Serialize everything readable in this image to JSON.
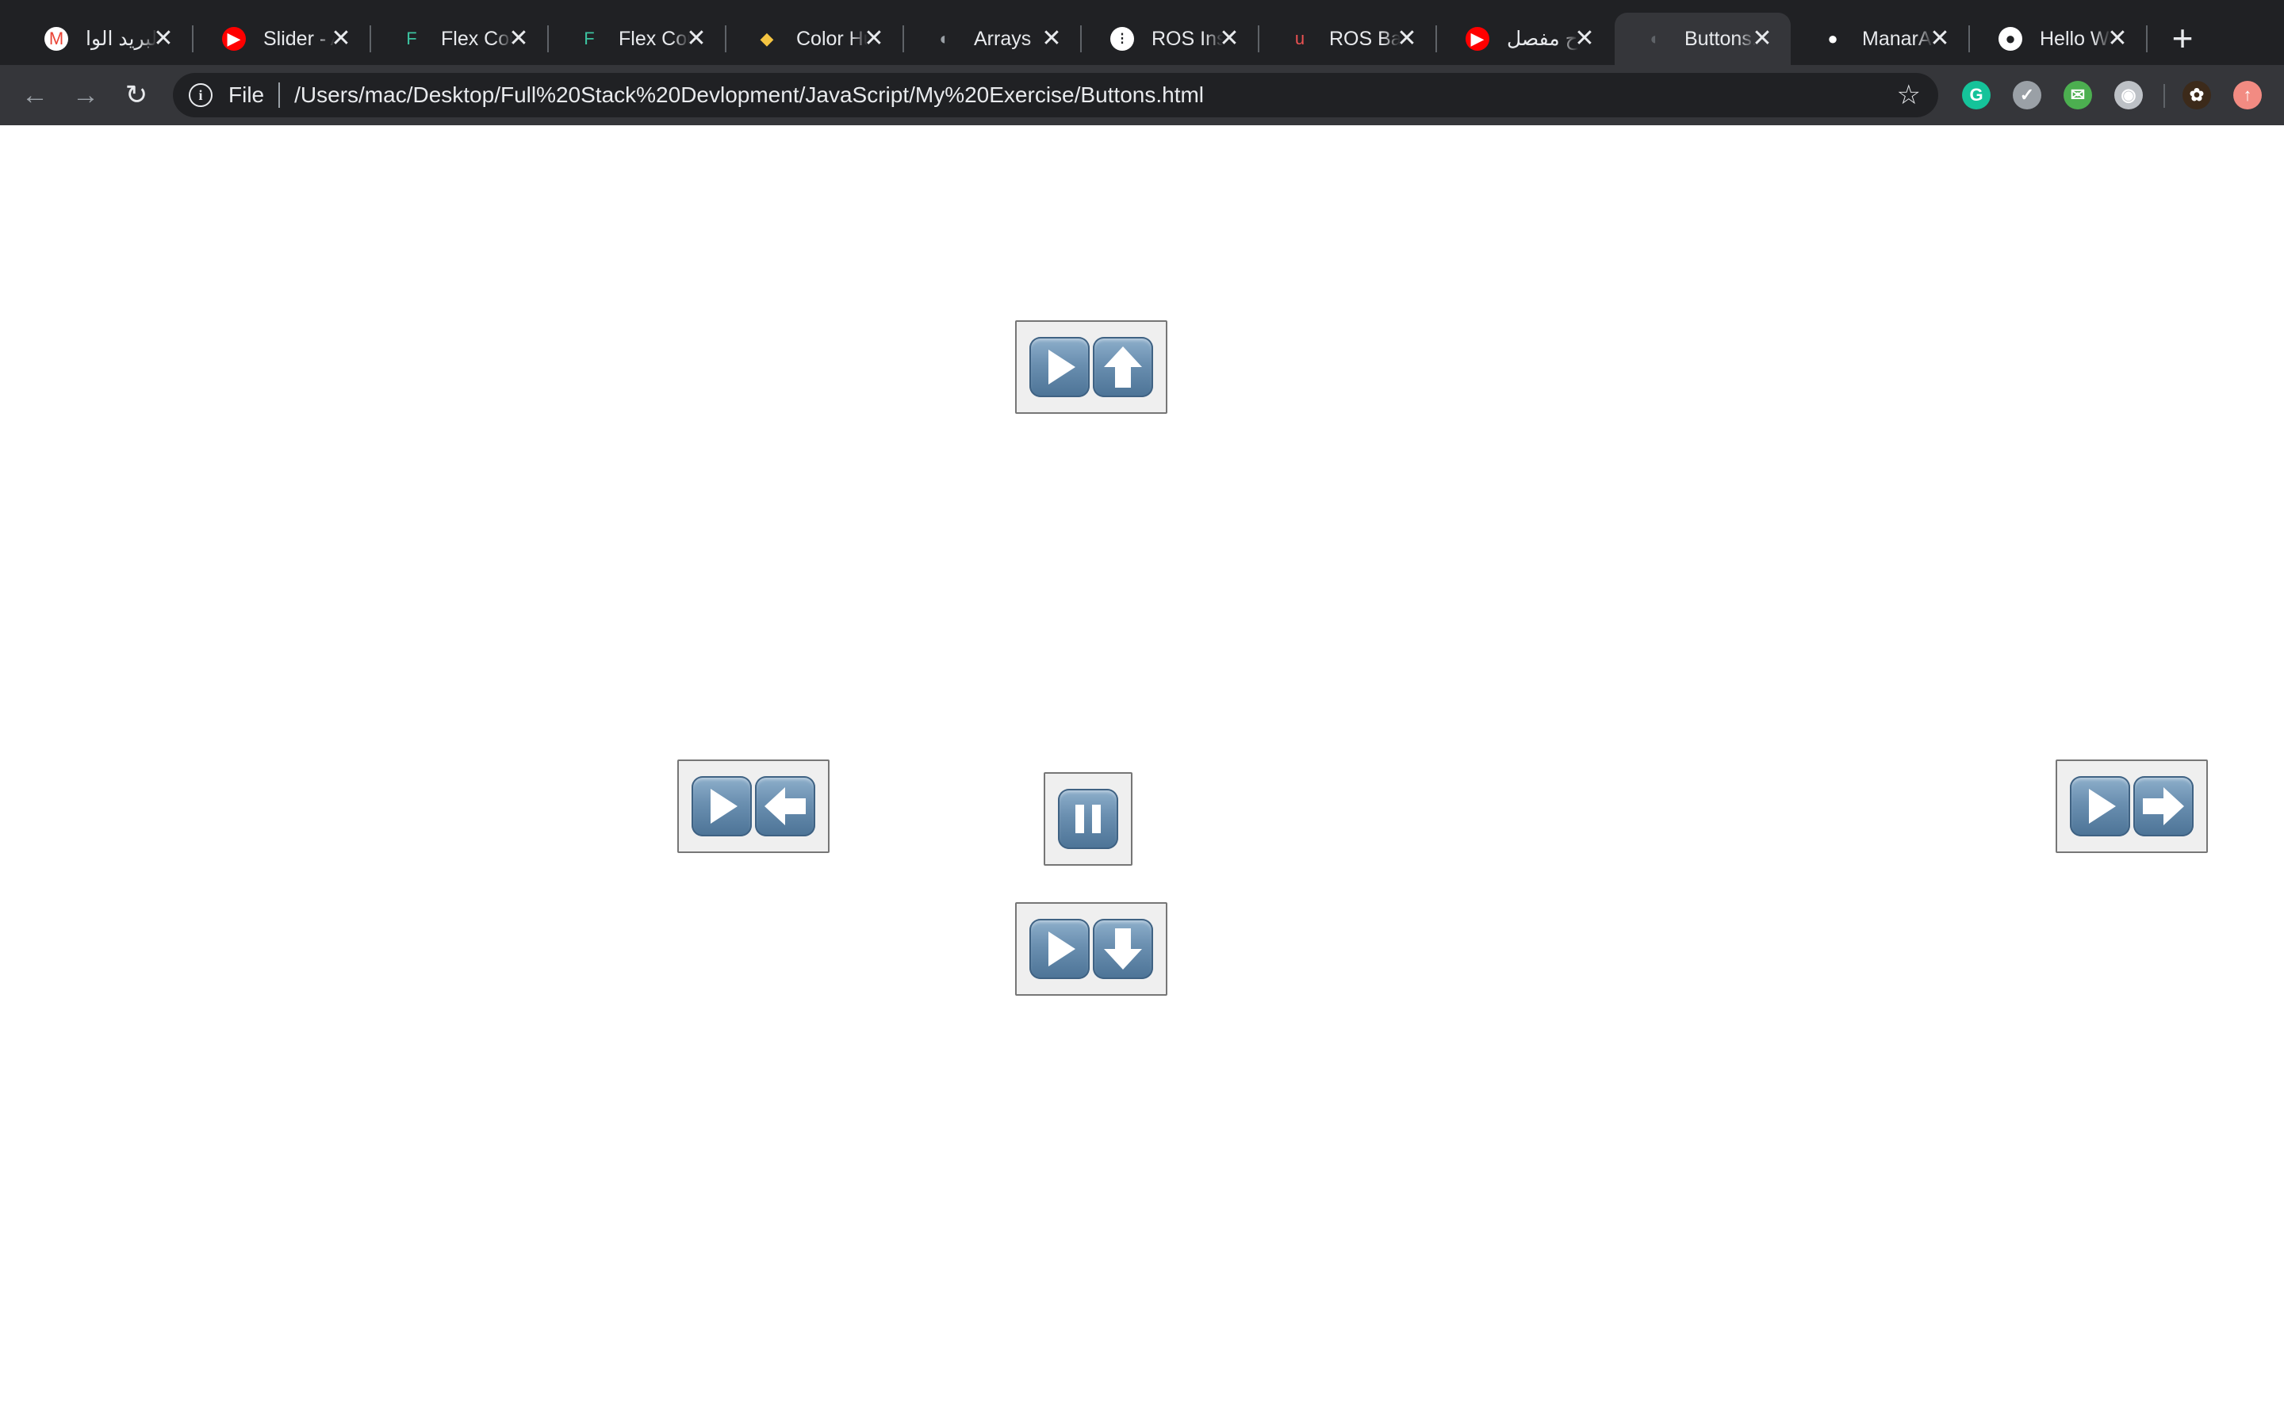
{
  "browser": {
    "tabs": [
      {
        "title": "البريد الوا",
        "favicon": "gmail-icon",
        "favicon_glyph": "M",
        "favicon_color": "#ea4335",
        "favicon_bg": "#ffffff",
        "active": false
      },
      {
        "title": "Slider - A",
        "favicon": "youtube-icon",
        "favicon_glyph": "▶",
        "favicon_color": "#ffffff",
        "favicon_bg": "#ff0000",
        "active": false
      },
      {
        "title": "Flex Course",
        "favicon": "flex-course-icon",
        "favicon_glyph": "F",
        "favicon_color": "#3cc3a0",
        "favicon_bg": "transparent",
        "active": false
      },
      {
        "title": "Flex Course",
        "favicon": "flex-course-icon",
        "favicon_glyph": "F",
        "favicon_color": "#3cc3a0",
        "favicon_bg": "transparent",
        "active": false
      },
      {
        "title": "Color Hunt",
        "favicon": "color-hunt-icon",
        "favicon_glyph": "◆",
        "favicon_color": "#f5c542",
        "favicon_bg": "transparent",
        "active": false
      },
      {
        "title": "Arrays",
        "favicon": "globe-icon",
        "favicon_glyph": "◐",
        "favicon_color": "#9aa0a6",
        "favicon_bg": "transparent",
        "active": false
      },
      {
        "title": "ROS Install",
        "favicon": "ros-icon",
        "favicon_glyph": "⁝",
        "favicon_color": "#202124",
        "favicon_bg": "#ffffff",
        "active": false
      },
      {
        "title": "ROS Basics",
        "favicon": "udemy-icon",
        "favicon_glyph": "u",
        "favicon_color": "#ec5252",
        "favicon_bg": "transparent",
        "active": false
      },
      {
        "title": "شرح مفصل",
        "favicon": "youtube-icon",
        "favicon_glyph": "▶",
        "favicon_color": "#ffffff",
        "favicon_bg": "#ff0000",
        "active": false
      },
      {
        "title": "Buttons.html",
        "favicon": "globe-icon",
        "favicon_glyph": "◐",
        "favicon_color": "#5f6368",
        "favicon_bg": "transparent",
        "active": true
      },
      {
        "title": "ManarAl",
        "favicon": "github-icon",
        "favicon_glyph": "●",
        "favicon_color": "#ffffff",
        "favicon_bg": "transparent",
        "active": false
      },
      {
        "title": "Hello World",
        "favicon": "github-icon",
        "favicon_glyph": "●",
        "favicon_color": "#202124",
        "favicon_bg": "#ffffff",
        "active": false
      }
    ],
    "close_glyph": "✕",
    "new_tab_glyph": "+",
    "nav": {
      "back_glyph": "←",
      "forward_glyph": "→",
      "reload_glyph": "↻"
    },
    "omnibox": {
      "info_glyph": "i",
      "scheme": "File",
      "url": "/Users/mac/Desktop/Full%20Stack%20Devlopment/JavaScript/My%20Exercise/Buttons.html",
      "star_glyph": "☆"
    },
    "extensions": [
      {
        "name": "grammarly-icon",
        "glyph": "G",
        "bg": "#15c39a"
      },
      {
        "name": "shield-icon",
        "glyph": "✓",
        "bg": "#9aa0a6"
      },
      {
        "name": "mail-extension-icon",
        "glyph": "✉",
        "bg": "#4caf50"
      },
      {
        "name": "record-icon",
        "glyph": "◉",
        "bg": "#bdc1c6"
      },
      {
        "name": "profile-avatar",
        "glyph": "✿",
        "bg": "#3c2a1a"
      },
      {
        "name": "update-icon",
        "glyph": "↑",
        "bg": "#f28b82"
      }
    ]
  },
  "controls": {
    "key_color": "#6a8fb0",
    "buttons": [
      {
        "name": "play-up-button",
        "keys": [
          "play",
          "up"
        ]
      },
      {
        "name": "play-left-button",
        "keys": [
          "play",
          "left"
        ]
      },
      {
        "name": "pause-button",
        "keys": [
          "pause"
        ]
      },
      {
        "name": "play-right-button",
        "keys": [
          "play",
          "right"
        ]
      },
      {
        "name": "play-down-button",
        "keys": [
          "play",
          "down"
        ]
      }
    ]
  }
}
